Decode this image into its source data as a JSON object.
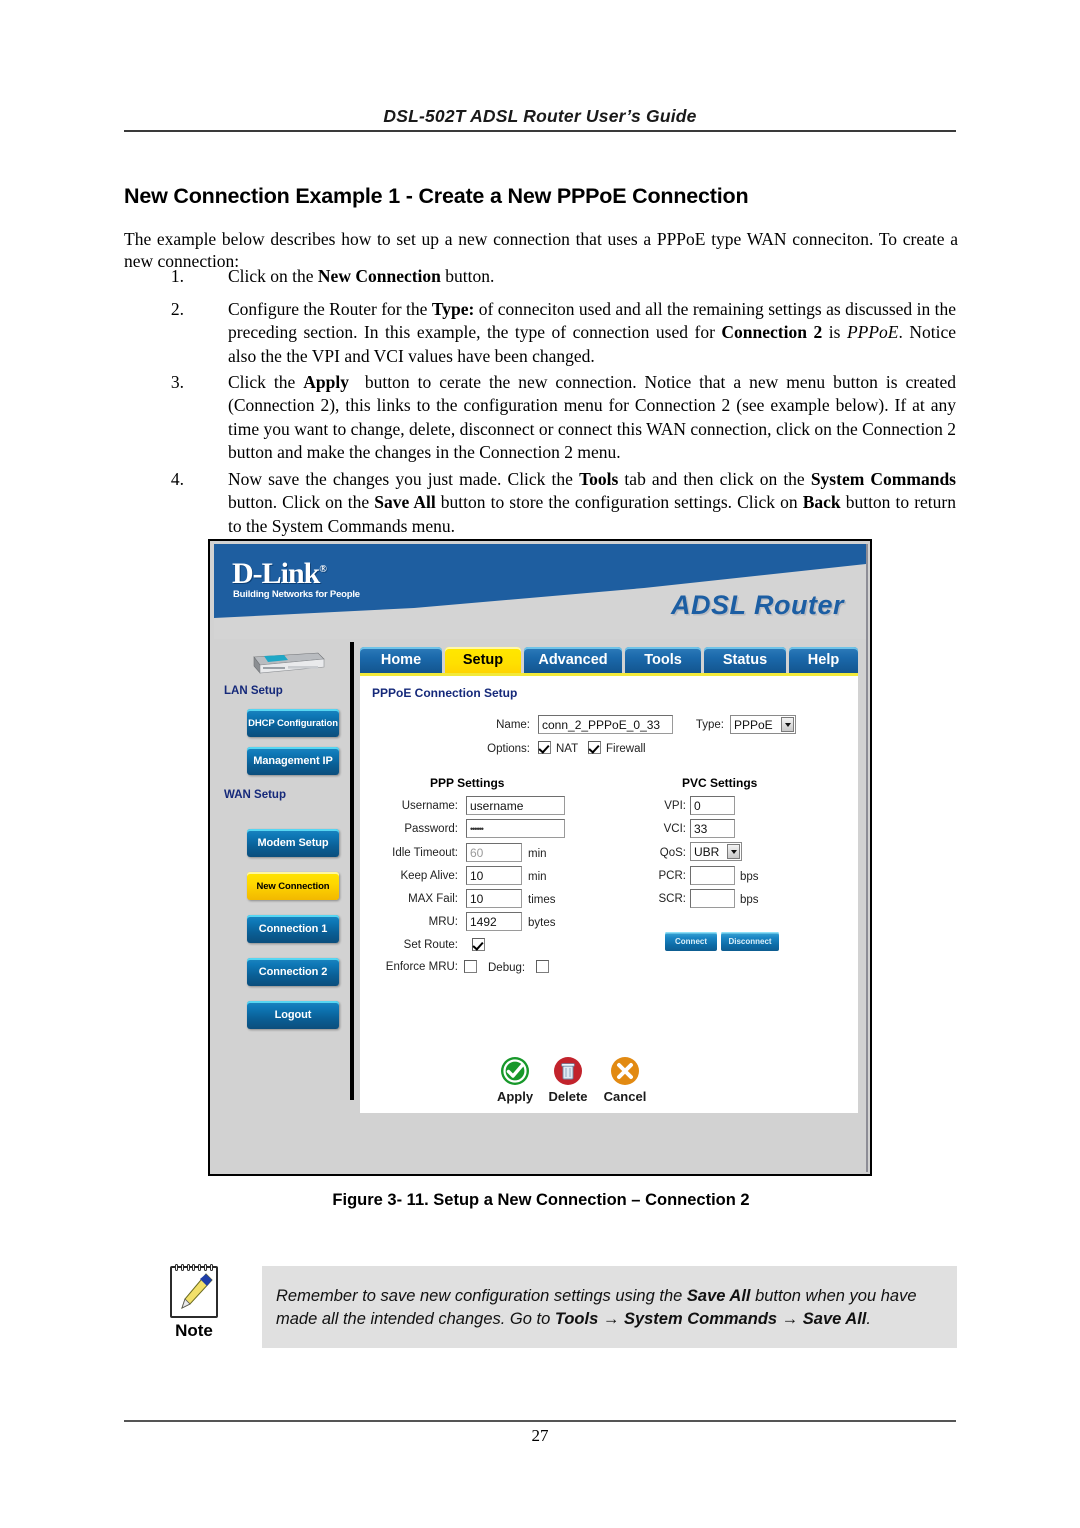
{
  "page": {
    "running_head": "DSL-502T ADSL Router User’s Guide",
    "heading": "New Connection Example 1 - Create a New PPPoE Connection",
    "intro": "The example below describes how to set up a new connection that uses a PPPoE type WAN conneciton. To create a new connection:",
    "folio": "27"
  },
  "steps": [
    {
      "num": "1.",
      "html": "Click on the <b class=\"bf\">New Connection</b> button."
    },
    {
      "num": "2.",
      "html": "Configure the Router for the <b class=\"bf\">Type:</b> of conneciton used and all the remaining settings as discussed in the preceding section. In this example, the type of connection used for <b class=\"bf\">Connection 2</b> is <i class=\"it\">PPPoE</i>. Notice also the the VPI and VCI values have been changed."
    },
    {
      "num": "3.",
      "html": "Click the <b class=\"bf\">Apply</b>&nbsp; button to cerate the new connection. Notice that a new menu button is created (Connection 2), this links to the configuration menu for Connection 2 (see example below). If at any time you want to change, delete, disconnect or connect this WAN connection, click on the Connection 2 button and make the changes in the Connection 2 menu."
    },
    {
      "num": "4.",
      "html": "Now save the changes you just made. Click the <b class=\"bf\">Tools</b> tab and then click on the <b class=\"bf\">System Commands</b> button. Click on the <b class=\"bf\">Save All</b> button to store the configuration settings. Click on <b class=\"bf\">Back</b> button to return to the System Commands menu."
    }
  ],
  "figure": {
    "caption": "Figure 3- 11. Setup a New Connection – Connection 2",
    "banner": {
      "logo": "D-Link",
      "registered": "®",
      "tagline": "Building Networks for People",
      "product_title": "ADSL Router",
      "brand_blue": "#1e5ea0",
      "title_blue": "#1c5ea3"
    },
    "tabs": [
      {
        "label": "Home",
        "active": false
      },
      {
        "label": "Setup",
        "active": true
      },
      {
        "label": "Advanced",
        "active": false
      },
      {
        "label": "Tools",
        "active": false
      },
      {
        "label": "Status",
        "active": false
      },
      {
        "label": "Help",
        "active": false
      }
    ],
    "sidebar": {
      "lan_heading": "LAN Setup",
      "wan_heading": "WAN Setup",
      "lan_buttons": [
        {
          "label": "DHCP Configuration",
          "active": false
        },
        {
          "label": "Management IP",
          "active": false
        }
      ],
      "wan_buttons": [
        {
          "label": "Modem Setup",
          "active": false
        },
        {
          "label": "New Connection",
          "active": true
        },
        {
          "label": "Connection 1",
          "active": false
        },
        {
          "label": "Connection 2",
          "active": false
        },
        {
          "label": "Logout",
          "active": false
        }
      ]
    },
    "form": {
      "panel_title": "PPPoE Connection Setup",
      "name_label": "Name:",
      "name_value": "conn_2_PPPoE_0_33",
      "type_label": "Type:",
      "type_value": "PPPoE",
      "options_label": "Options:",
      "option_nat": "NAT",
      "option_nat_checked": true,
      "option_firewall": "Firewall",
      "option_firewall_checked": true,
      "ppp": {
        "title": "PPP Settings",
        "username_label": "Username:",
        "username_value": "username",
        "password_label": "Password:",
        "password_value": "••••••",
        "idle_timeout_label": "Idle Timeout:",
        "idle_timeout_value": "60",
        "idle_timeout_unit": "min",
        "keep_alive_label": "Keep Alive:",
        "keep_alive_value": "10",
        "keep_alive_unit": "min",
        "max_fail_label": "MAX Fail:",
        "max_fail_value": "10",
        "max_fail_unit": "times",
        "mru_label": "MRU:",
        "mru_value": "1492",
        "mru_unit": "bytes",
        "set_route_label": "Set Route:",
        "set_route_checked": true,
        "enforce_mru_label": "Enforce MRU:",
        "enforce_mru_checked": false,
        "debug_label": "Debug:",
        "debug_checked": false
      },
      "pvc": {
        "title": "PVC Settings",
        "vpi_label": "VPI:",
        "vpi_value": "0",
        "vci_label": "VCI:",
        "vci_value": "33",
        "qos_label": "QoS:",
        "qos_value": "UBR",
        "pcr_label": "PCR:",
        "pcr_value": "",
        "pcr_unit": "bps",
        "scr_label": "SCR:",
        "scr_value": "",
        "scr_unit": "bps",
        "connect_label": "Connect",
        "disconnect_label": "Disconnect"
      },
      "actions": [
        {
          "label": "Apply",
          "icon": "check-circle-icon",
          "color": "#1f9b1f"
        },
        {
          "label": "Delete",
          "icon": "trash-circle-icon",
          "color": "#c4232b"
        },
        {
          "label": "Cancel",
          "icon": "x-circle-icon",
          "color": "#e08a12"
        }
      ]
    }
  },
  "note": {
    "label": "Note",
    "icon": "notepad-pencil-icon",
    "html": "Remember to save new configuration settings using the <b class=\"bf\">Save All</b> button when you have made all the intended changes. Go to <b class=\"bf\">Tools</b> <b class=\"bf\">→</b> <b class=\"bf\">System Commands</b> <b class=\"bf\">→</b> <b class=\"bf\">Save All</b>."
  }
}
